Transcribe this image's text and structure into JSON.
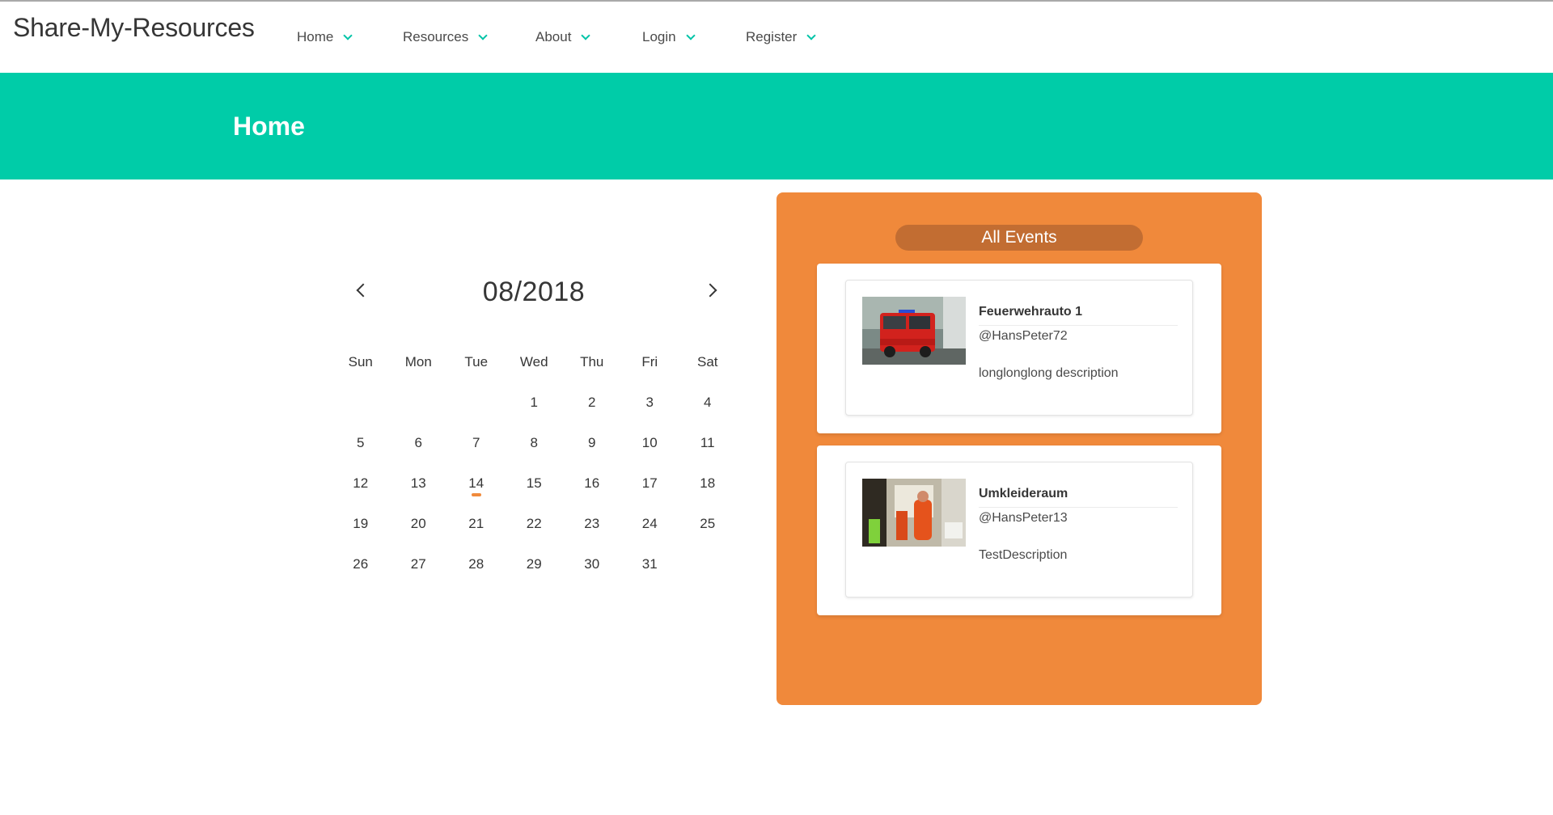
{
  "brand": "Share-My-Resources",
  "nav": [
    {
      "label": "Home"
    },
    {
      "label": "Resources"
    },
    {
      "label": "About"
    },
    {
      "label": "Login"
    },
    {
      "label": "Register"
    }
  ],
  "hero": {
    "title": "Home"
  },
  "calendar": {
    "month_label": "08/2018",
    "weekdays": [
      "Sun",
      "Mon",
      "Tue",
      "Wed",
      "Thu",
      "Fri",
      "Sat"
    ],
    "days": [
      [
        "",
        "",
        "",
        "1",
        "2",
        "3",
        "4"
      ],
      [
        "5",
        "6",
        "7",
        "8",
        "9",
        "10",
        "11"
      ],
      [
        "12",
        "13",
        "14",
        "15",
        "16",
        "17",
        "18"
      ],
      [
        "19",
        "20",
        "21",
        "22",
        "23",
        "24",
        "25"
      ],
      [
        "26",
        "27",
        "28",
        "29",
        "30",
        "31",
        ""
      ]
    ],
    "marked_day": "14",
    "marker_color": "#f08a3c"
  },
  "events": {
    "heading": "All Events",
    "items": [
      {
        "title": "Feuerwehrauto 1",
        "user": "@HansPeter72",
        "description": "longlonglong description"
      },
      {
        "title": "Umkleideraum",
        "user": "@HansPeter13",
        "description": "TestDescription"
      }
    ]
  },
  "colors": {
    "hero": "#00cca8",
    "accent": "#00c4a7",
    "panel": "#f0893b",
    "pill": "#c26d32"
  }
}
